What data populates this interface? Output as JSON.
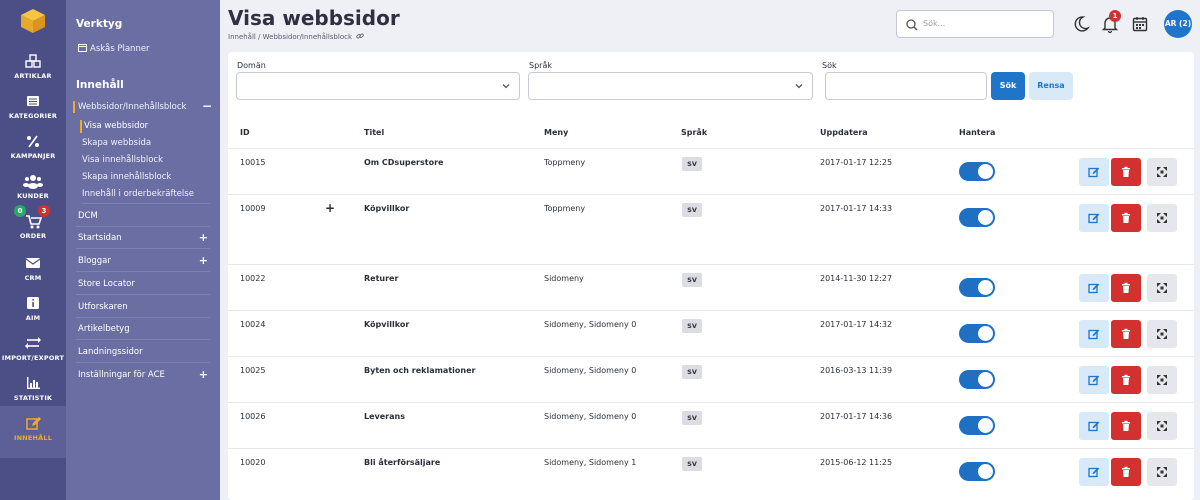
{
  "rail": {
    "items": [
      {
        "label": "ARTIKLAR",
        "icon": "boxes-icon"
      },
      {
        "label": "KATEGORIER",
        "icon": "list-icon"
      },
      {
        "label": "KAMPANJER",
        "icon": "percent-icon"
      },
      {
        "label": "KUNDER",
        "icon": "users-icon"
      },
      {
        "label": "ORDER",
        "icon": "cart-icon"
      },
      {
        "label": "CRM",
        "icon": "mail-icon"
      },
      {
        "label": "AIM",
        "icon": "info-icon"
      },
      {
        "label": "IMPORT/EXPORT",
        "icon": "swap-icon"
      },
      {
        "label": "STATISTIK",
        "icon": "chart-icon"
      },
      {
        "label": "INNEHÅLL",
        "icon": "edit-icon"
      }
    ],
    "order_badges": {
      "green": "0",
      "red": "3"
    },
    "active_color": "#f3a92b"
  },
  "subnav": {
    "tools_title": "Verktyg",
    "tools_item": "Askås Planner",
    "content_title": "Innehåll",
    "group_label": "Webbsidor/Innehållsblock",
    "group_toggle": "−",
    "sub_items": [
      "Visa webbsidor",
      "Skapa webbsida",
      "Visa innehållsblock",
      "Skapa innehållsblock",
      "Innehåll i orderbekräftelse"
    ],
    "rows": [
      {
        "label": "DCM",
        "plus": ""
      },
      {
        "label": "Startsidan",
        "plus": "+"
      },
      {
        "label": "Bloggar",
        "plus": "+"
      },
      {
        "label": "Store Locator",
        "plus": ""
      },
      {
        "label": "Utforskaren",
        "plus": ""
      },
      {
        "label": "Artikelbetyg",
        "plus": ""
      },
      {
        "label": "Landningssidor",
        "plus": ""
      },
      {
        "label": "Inställningar för ACE",
        "plus": "+"
      }
    ]
  },
  "header": {
    "title": "Visa webbsidor",
    "breadcrumb": "Innehåll / Webbsidor/Innehållsblock",
    "search_placeholder": "Sök...",
    "notification_count": "1",
    "avatar": "AR (2)"
  },
  "filters": {
    "domain_label": "Domän",
    "language_label": "Språk",
    "search_label": "Sök",
    "search_button": "Sök",
    "clear_button": "Rensa"
  },
  "table": {
    "headers": {
      "id": "ID",
      "title": "Titel",
      "menu": "Meny",
      "language": "Språk",
      "updated": "Uppdatera",
      "manage": "Hantera"
    },
    "rows": [
      {
        "id": "10015",
        "expander": "",
        "title": "Om CDsuperstore",
        "menu": "Toppmeny",
        "lang": "SV",
        "updated": "2017-01-17 12:25",
        "active": true
      },
      {
        "id": "10009",
        "expander": "+",
        "title": "Köpvillkor",
        "menu": "Toppmeny",
        "lang": "SV",
        "updated": "2017-01-17 14:33",
        "active": true
      },
      {
        "id": "10022",
        "expander": "",
        "title": "Returer",
        "menu": "Sidomeny",
        "lang": "SV",
        "updated": "2014-11-30 12:27",
        "active": true
      },
      {
        "id": "10024",
        "expander": "",
        "title": "Köpvillkor",
        "menu": "Sidomeny, Sidomeny 0",
        "lang": "SV",
        "updated": "2017-01-17 14:32",
        "active": true
      },
      {
        "id": "10025",
        "expander": "",
        "title": "Byten och reklamationer",
        "menu": "Sidomeny, Sidomeny 0",
        "lang": "SV",
        "updated": "2016-03-13 11:39",
        "active": true
      },
      {
        "id": "10026",
        "expander": "",
        "title": "Leverans",
        "menu": "Sidomeny, Sidomeny 0",
        "lang": "SV",
        "updated": "2017-01-17 14:36",
        "active": true
      },
      {
        "id": "10020",
        "expander": "",
        "title": "Bli återförsäljare",
        "menu": "Sidomeny, Sidomeny 1",
        "lang": "SV",
        "updated": "2015-06-12 11:25",
        "active": true
      }
    ]
  },
  "colors": {
    "primary": "#1f75c9",
    "danger": "#d3312f",
    "rail": "#4c4f86",
    "subnav": "#6b6ea3"
  }
}
